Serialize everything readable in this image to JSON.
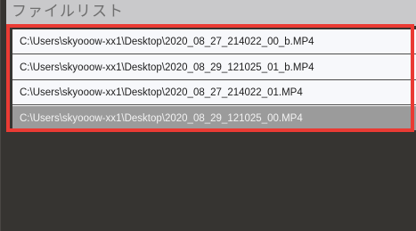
{
  "header": {
    "title": "ファイルリスト"
  },
  "file_list": {
    "items": [
      {
        "path": "C:\\Users\\skyooow-xx1\\Desktop\\2020_08_27_214022_00_b.MP4",
        "selected": false
      },
      {
        "path": "C:\\Users\\skyooow-xx1\\Desktop\\2020_08_29_121025_01_b.MP4",
        "selected": false
      },
      {
        "path": "C:\\Users\\skyooow-xx1\\Desktop\\2020_08_27_214022_01.MP4",
        "selected": false
      },
      {
        "path": "C:\\Users\\skyooow-xx1\\Desktop\\2020_08_29_121025_00.MP4",
        "selected": true
      }
    ]
  },
  "colors": {
    "panel_background": "#363431",
    "header_background": "#c9c9cb",
    "row_background": "#f7f8fb",
    "selected_row_background": "#9b9b9b",
    "annotation_border": "#ea3b34"
  }
}
